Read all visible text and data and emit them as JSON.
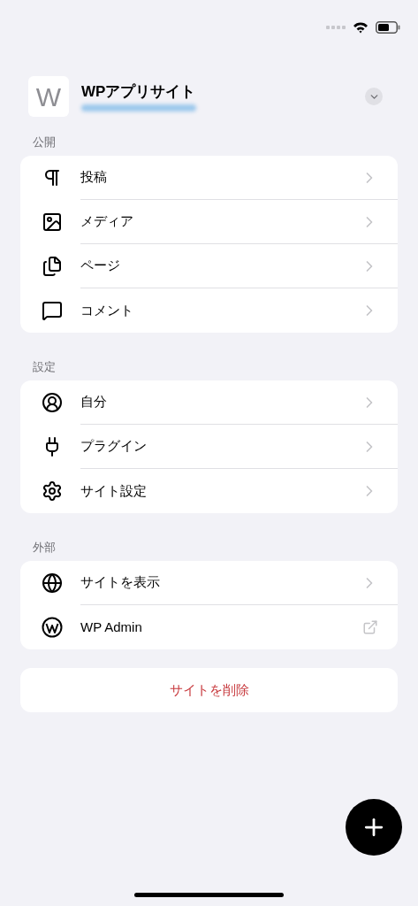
{
  "site": {
    "initial": "W",
    "name": "WPアプリサイト"
  },
  "sections": [
    {
      "title": "公開",
      "items": [
        {
          "label": "投稿",
          "kind": "link"
        },
        {
          "label": "メディア",
          "kind": "link"
        },
        {
          "label": "ページ",
          "kind": "link"
        },
        {
          "label": "コメント",
          "kind": "link"
        }
      ]
    },
    {
      "title": "設定",
      "items": [
        {
          "label": "自分",
          "kind": "link"
        },
        {
          "label": "プラグイン",
          "kind": "link"
        },
        {
          "label": "サイト設定",
          "kind": "link"
        }
      ]
    },
    {
      "title": "外部",
      "items": [
        {
          "label": "サイトを表示",
          "kind": "link"
        },
        {
          "label": "WP Admin",
          "kind": "external"
        }
      ]
    }
  ],
  "delete_button": "サイトを削除"
}
